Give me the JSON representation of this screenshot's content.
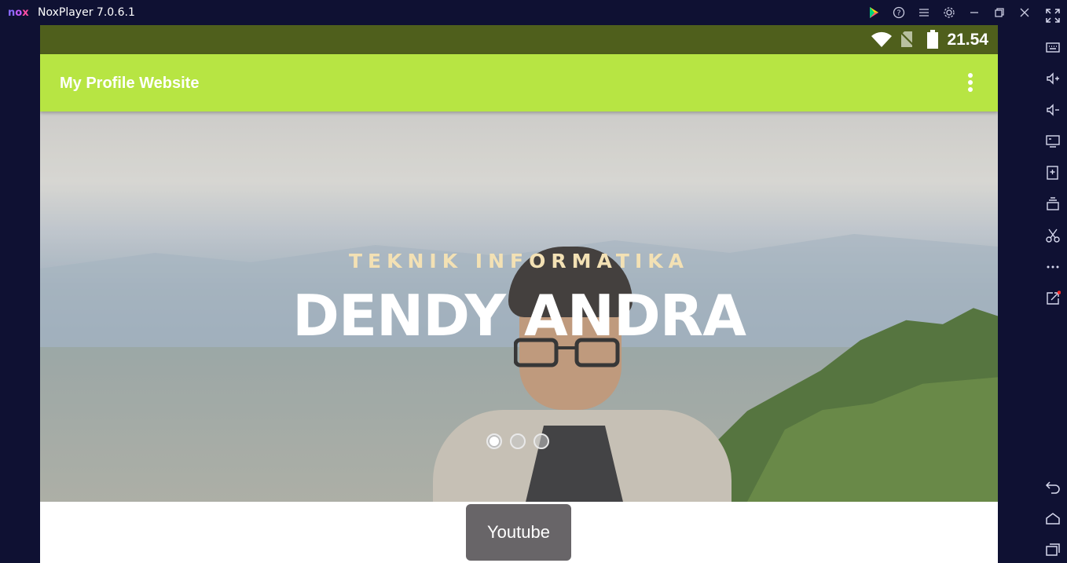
{
  "window": {
    "logo": {
      "n": "n",
      "o": "o",
      "x": "x"
    },
    "title": "NoxPlayer 7.0.6.1",
    "buttons": [
      "play-store-icon",
      "help-icon",
      "menu-icon",
      "settings-icon",
      "minimize-icon",
      "restore-icon",
      "close-icon",
      "fullscreen-icon"
    ]
  },
  "sidebar": {
    "tools": [
      "keyboard-icon",
      "volume-up-icon",
      "volume-down-icon",
      "screen-icon",
      "add-apk-icon",
      "multi-instance-icon",
      "screenshot-icon",
      "more-icon",
      "external-link-icon"
    ],
    "nav": [
      "back-icon",
      "home-icon",
      "recents-icon"
    ]
  },
  "android": {
    "status": {
      "time": "21.54"
    },
    "appbar": {
      "title": "My Profile Website"
    },
    "hero": {
      "subtitle": "TEKNIK INFORMATIKA",
      "title": "DENDY ANDRA",
      "carousel_active_index": 0,
      "carousel_count": 3
    },
    "youtube_button": "Youtube"
  },
  "colors": {
    "emulator_bg": "#0f1133",
    "statusbar": "#4f5f1c",
    "appbar": "#b7e543",
    "subtitle": "#f3e1b4",
    "button": "#686568"
  }
}
